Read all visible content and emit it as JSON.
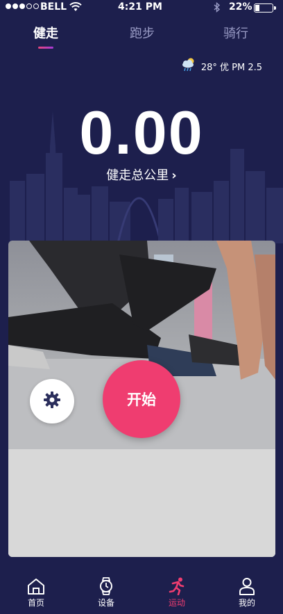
{
  "status_bar": {
    "carrier": "BELL",
    "time": "4:21 PM",
    "battery_percent": "22%",
    "signal_bars_filled": 3,
    "signal_bars_total": 5
  },
  "tabs": [
    {
      "label": "健走",
      "active": true
    },
    {
      "label": "跑步",
      "active": false
    },
    {
      "label": "骑行",
      "active": false
    }
  ],
  "weather": {
    "icon": "cloud-sun-rain-icon",
    "text": "28° 优  PM 2.5"
  },
  "distance": {
    "value": "0.00",
    "label": "健走总公里",
    "label_icon": "chevron-right-icon"
  },
  "controls": {
    "settings_icon": "gear-icon",
    "start_label": "开始"
  },
  "bottom_nav": [
    {
      "label": "首页",
      "icon": "home-icon",
      "active": false
    },
    {
      "label": "设备",
      "icon": "watch-icon",
      "active": false
    },
    {
      "label": "运动",
      "icon": "running-icon",
      "active": true
    },
    {
      "label": "我的",
      "icon": "user-icon",
      "active": false
    }
  ],
  "colors": {
    "background": "#1d1f4d",
    "accent": "#ef3d70",
    "inactive_tab": "#9a9cc6"
  }
}
